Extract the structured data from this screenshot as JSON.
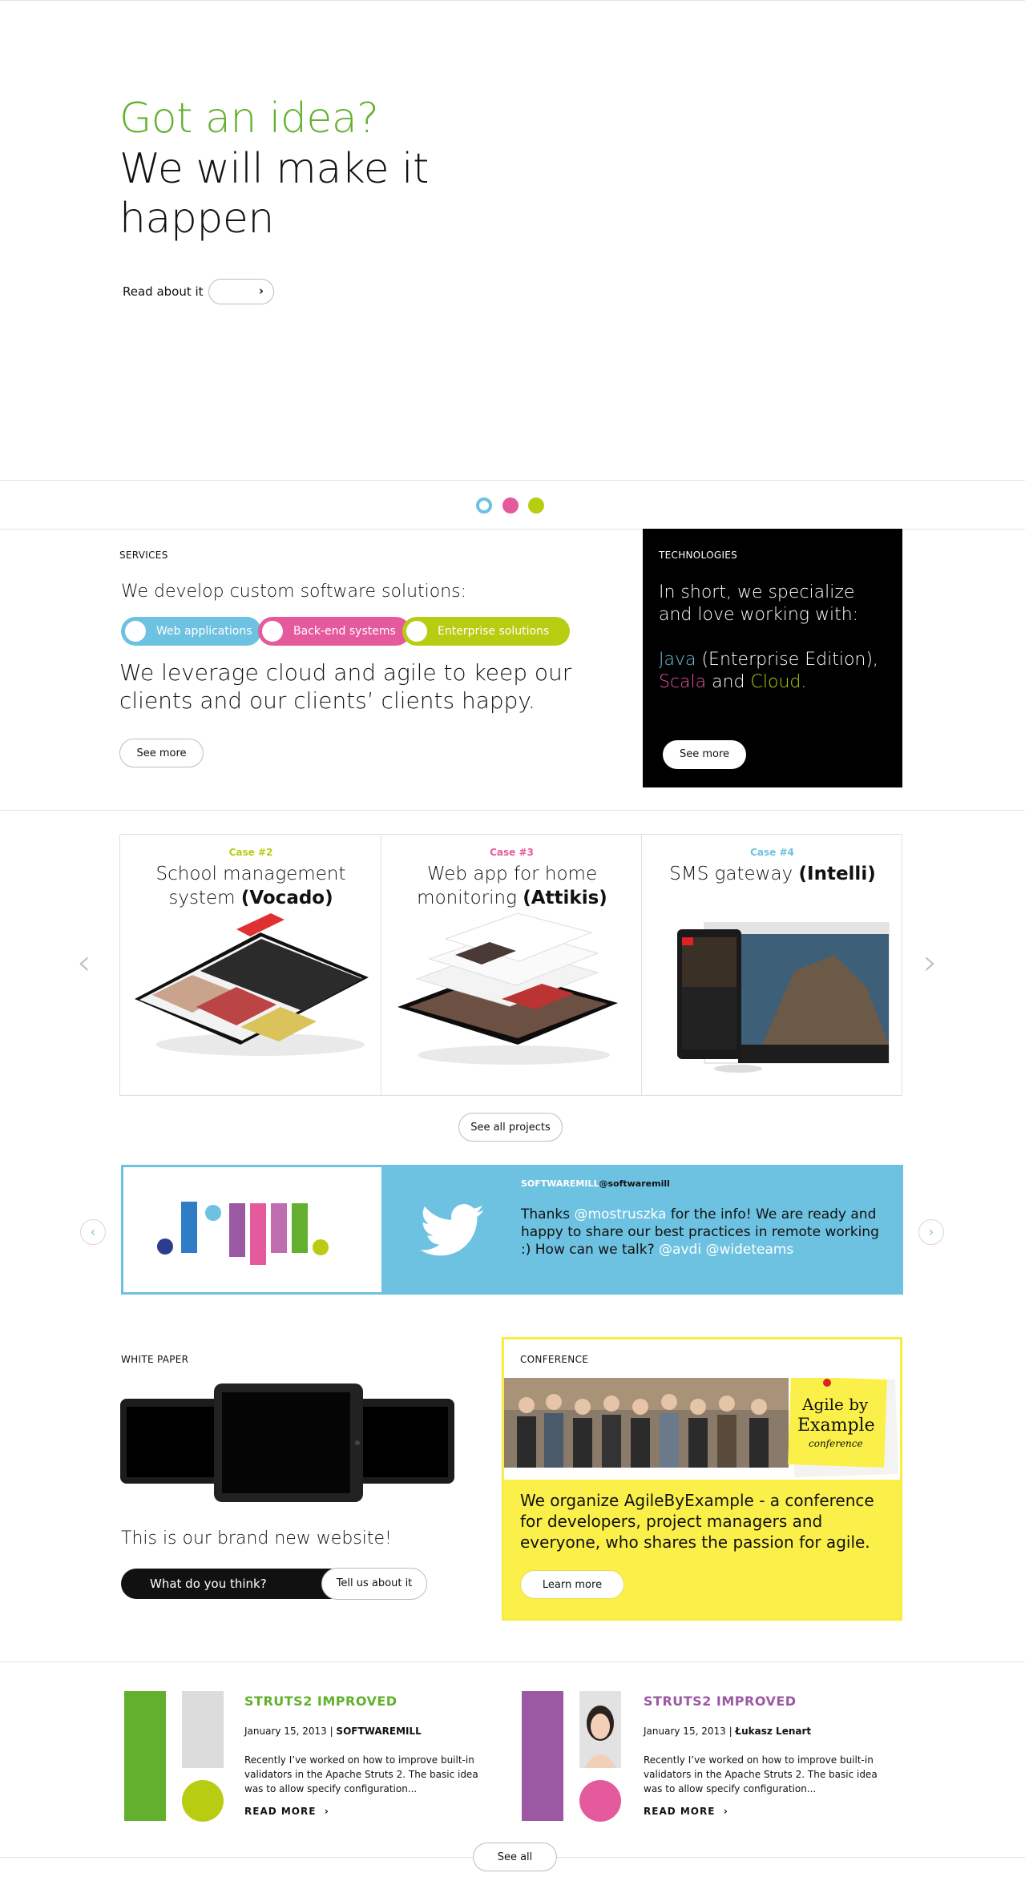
{
  "hero": {
    "headline_accent": "Got an idea?",
    "headline_rest": "We will make it happen",
    "read_label": "Read about it",
    "read_icon": "chevron-right-icon",
    "accent_color": "#62b02e"
  },
  "slider_dots": [
    "#6ec2e1",
    "#e55a9d",
    "#b8cd12"
  ],
  "services": {
    "label": "SERVICES",
    "intro": "We develop custom software solutions:",
    "pills": [
      {
        "label": "Web applications",
        "color": "#6ec2e1"
      },
      {
        "label": "Back-end systems",
        "color": "#e55a9d"
      },
      {
        "label": "Enterprise solutions",
        "color": "#b8cd12"
      }
    ],
    "statement": "We leverage cloud and agile to keep our clients and our clients’ clients happy.",
    "button": "See more"
  },
  "technologies": {
    "label": "TECHNOLOGIES",
    "intro": "In short, we specialize and love working with:",
    "java": "Java",
    "java_rest": " (Enterprise Edition),",
    "scala": "Scala",
    "and": " and ",
    "cloud": "Cloud",
    "dot": ".",
    "button": "See more",
    "colors": {
      "java": "#6ec2e1",
      "scala": "#e55a9d",
      "cloud": "#b8cd12"
    }
  },
  "cases": [
    {
      "tag": "Case #2",
      "title": "School management system",
      "client": "(Vocado)",
      "color": "#b8cd12"
    },
    {
      "tag": "Case #3",
      "title": "Web app for home monitoring",
      "client": "(Attikis)",
      "color": "#e55a9d"
    },
    {
      "tag": "Case #4",
      "title": "SMS gateway",
      "client": "(Intelli)",
      "color": "#6ec2e1"
    }
  ],
  "cases_button": "See all projects",
  "twitter": {
    "author": "SOFTWAREMILL",
    "handle": "@softwaremill",
    "t1": "Thanks ",
    "m1": "@mostruszka",
    "t2": " for the info! We are ready and happy to share our best practices in remote working :) How can we talk? ",
    "m2": "@avdi",
    "m3": "@wideteams"
  },
  "white_paper": {
    "label": "WHITE PAPER",
    "subtitle": "This is our brand new website!",
    "question": "What do you think?",
    "button": "Tell us about it"
  },
  "conference": {
    "label": "CONFERENCE",
    "logo_l1": "Agile by",
    "logo_l2": "Example",
    "logo_l3": "conference",
    "text": "We organize AgileByExample - a conference for developers, project managers and everyone, who shares the passion for agile.",
    "button": "Learn more"
  },
  "blog": [
    {
      "title": "STRUTS2 IMPROVED",
      "date": "January 15, 2013",
      "author": "SOFTWAREMILL",
      "excerpt": "Recently I’ve worked on how to improve built-in validators in the Apache Struts 2. The basic idea was to allow specify configuration...",
      "more": "READ MORE",
      "color": "#62b02e"
    },
    {
      "title": "STRUTS2 IMPROVED",
      "date": "January 15, 2013",
      "author": "Łukasz Lenart",
      "excerpt": "Recently I’ve worked on how to improve built-in validators in the Apache Struts 2. The basic idea was to allow specify configuration...",
      "more": "READ MORE",
      "color": "#9b59a3"
    }
  ],
  "blog_sep": " | ",
  "see_all": "See all"
}
